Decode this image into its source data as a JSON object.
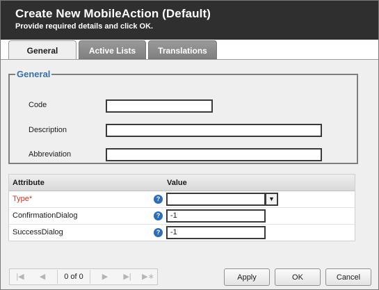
{
  "dialog": {
    "title": "Create New MobileAction (Default)",
    "subtitle": "Provide required details and click OK."
  },
  "tabs": [
    {
      "label": "General",
      "active": true
    },
    {
      "label": "Active Lists",
      "active": false
    },
    {
      "label": "Translations",
      "active": false
    }
  ],
  "general": {
    "legend": "General",
    "fields": [
      {
        "label": "Code",
        "value": ""
      },
      {
        "label": "Description",
        "value": ""
      },
      {
        "label": "Abbreviation",
        "value": ""
      }
    ]
  },
  "attributes": {
    "headers": [
      "Attribute",
      "Value"
    ],
    "rows": [
      {
        "name": "Type*",
        "value": "",
        "required": true
      },
      {
        "name": "ConfirmationDialog",
        "value": "-1"
      },
      {
        "name": "SuccessDialog",
        "value": "-1"
      }
    ],
    "help_glyph": "?"
  },
  "pager": {
    "text": "0 of 0",
    "icons": [
      "first-page-icon",
      "prev-page-icon",
      "next-page-icon",
      "last-page-icon",
      "refresh-icon"
    ]
  },
  "buttons": {
    "apply": "Apply",
    "ok": "OK",
    "cancel": "Cancel"
  },
  "colors": {
    "titlebar": "#2f2f2f",
    "legend": "#3a6fa5",
    "required": "#c0392b",
    "help": "#2f6db3"
  }
}
